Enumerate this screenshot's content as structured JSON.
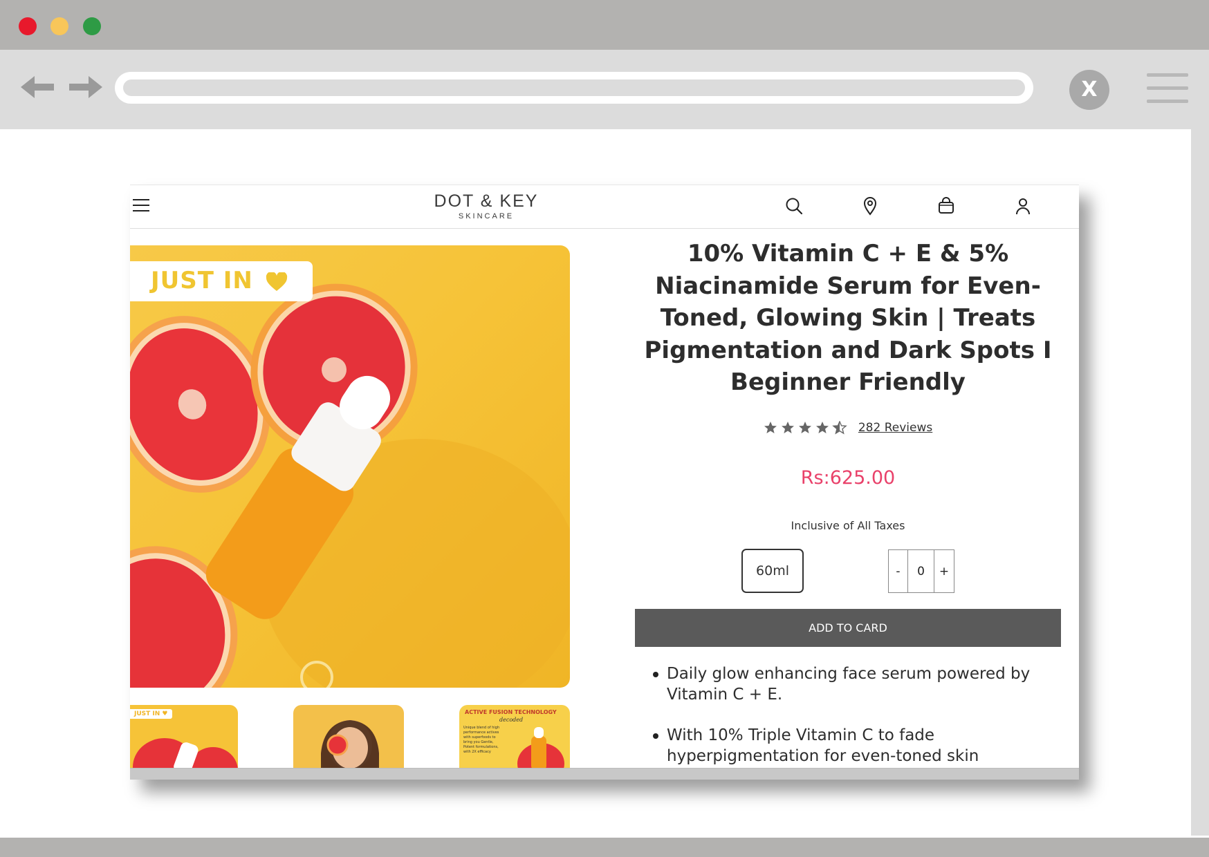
{
  "browser": {
    "close_glyph": "X",
    "icons": [
      "back-arrow-icon",
      "forward-arrow-icon",
      "close-icon",
      "menu-icon"
    ]
  },
  "site": {
    "logo": {
      "main": "DOT & KEY",
      "sub": "SKINCARE"
    },
    "header_icons": [
      "hamburger-icon",
      "search-icon",
      "location-pin-icon",
      "shopping-bag-icon",
      "user-icon"
    ],
    "badge": "JUST IN",
    "thumbnails": {
      "thumb1_tag": "JUST IN ♥",
      "thumb3_title": "ACTIVE FUSION TECHNOLOGY",
      "thumb3_sub": "decoded",
      "thumb3_body": "Unique blend of high performance actives with superfoods to bring you Gentle, Potent formulations, with 2X efficacy"
    },
    "product": {
      "title": "10% Vitamin C + E & 5% Niacinamide Serum for Even-Toned, Glowing Skin | Treats Pigmentation and Dark Spots I Beginner Friendly",
      "rating": 4.5,
      "reviews": "282 Reviews",
      "price": "Rs:625.00",
      "tax_note": "Inclusive of All Taxes",
      "size": "60ml",
      "qty_minus": "-",
      "qty_value": "0",
      "qty_plus": "+",
      "add_button": "ADD TO CARD",
      "bullets": [
        "Daily glow enhancing face serum powered by Vitamin C + E.",
        "With 10% Triple Vitamin C to fade hyperpigmentation for even-toned skin"
      ]
    },
    "colors": {
      "price": "#e9416a",
      "add_button": "#5a5a5a",
      "image_bg": "#f6c338",
      "badge_text": "#f0c531"
    }
  }
}
